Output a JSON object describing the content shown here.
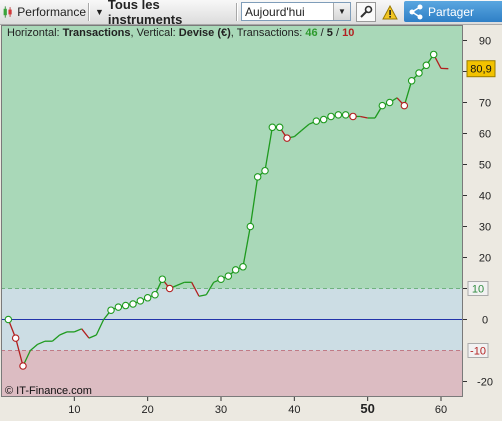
{
  "toolbar": {
    "performance_label": "Performance",
    "instruments_label": "Tous les instruments",
    "period_value": "Aujourd'hui",
    "share_label": "Partager",
    "icons": {
      "performance": "candlestick-icon",
      "period_dropdown": "chevron-down-icon",
      "tool": "wrench-icon",
      "alert": "warning-icon",
      "share": "share-icon"
    }
  },
  "chart_header": {
    "prefix": "Horizontal: ",
    "horizontal": "Transactions",
    "mid": ", Vertical: ",
    "vertical": "Devise (€)",
    "suffix": ", Transactions: ",
    "count_wins": "46",
    "sep1": " / ",
    "count_neutral": "5",
    "sep2": " / ",
    "count_losses": "10"
  },
  "watermark": "© IT-Finance.com",
  "colors": {
    "profit_zone": "#a9d8b8",
    "neutral_zone": "#ccdde4",
    "loss_zone": "#dcbcc2",
    "line_up": "#1e9a1e",
    "line_down": "#b21e1e",
    "zero_line": "#2233aa",
    "last_value_badge": "#f2c200"
  },
  "chart_data": {
    "type": "line",
    "xlabel": "",
    "ylabel": "",
    "xlim": [
      0,
      63
    ],
    "ylim": [
      -25,
      95
    ],
    "x_ticks": [
      10,
      20,
      30,
      40,
      50,
      60
    ],
    "x_tick_labels": [
      "10",
      "20",
      "30",
      "40",
      "50",
      "60"
    ],
    "x_highlight_tick": 50,
    "y_ticks": [
      -20,
      0,
      10,
      20,
      30,
      40,
      50,
      60,
      70,
      80,
      90
    ],
    "y_tick_labels": [
      "-20",
      "0",
      "10",
      "20",
      "30",
      "40",
      "50",
      "60",
      "70",
      "80",
      "90"
    ],
    "zones": {
      "upper_threshold": 10,
      "lower_threshold": -10
    },
    "threshold_labels": [
      "10",
      "-10"
    ],
    "last_value": 80.9,
    "last_value_label": "80,9",
    "grid": false,
    "legend": "none",
    "series": [
      {
        "x": [
          1,
          2,
          3,
          4,
          5,
          6,
          7,
          8,
          9,
          10,
          11,
          12,
          13,
          14,
          15,
          16,
          17,
          18,
          19,
          20,
          21,
          22,
          23,
          24,
          25,
          26,
          27,
          28,
          29,
          30,
          31,
          32,
          33,
          34,
          35,
          36,
          37,
          38,
          39,
          40,
          41,
          42,
          43,
          44,
          45,
          46,
          47,
          48,
          49,
          50,
          51,
          52,
          53,
          54,
          55,
          56,
          57,
          58,
          59,
          60,
          61
        ],
        "y": [
          0,
          -6,
          -15,
          -10,
          -8,
          -7,
          -7,
          -5,
          -4,
          -4,
          -3,
          -6,
          -5,
          0,
          3,
          4,
          4.5,
          5,
          6,
          7,
          8,
          13,
          10,
          11,
          12,
          12,
          7.5,
          8,
          12,
          13,
          14,
          16,
          17,
          30,
          46,
          48,
          62,
          62,
          58.5,
          59,
          61,
          63,
          64,
          64.5,
          65.5,
          66,
          66,
          65.5,
          65.5,
          65,
          65,
          69,
          70,
          71.5,
          69,
          77,
          79.5,
          82,
          85.5,
          81,
          80.9
        ],
        "markers": [
          1,
          2,
          3,
          15,
          16,
          17,
          18,
          19,
          20,
          21,
          22,
          23,
          30,
          31,
          32,
          33,
          34,
          35,
          36,
          37,
          38,
          39,
          43,
          44,
          45,
          46,
          47,
          48,
          52,
          53,
          55,
          56,
          57,
          58,
          59
        ]
      }
    ]
  }
}
